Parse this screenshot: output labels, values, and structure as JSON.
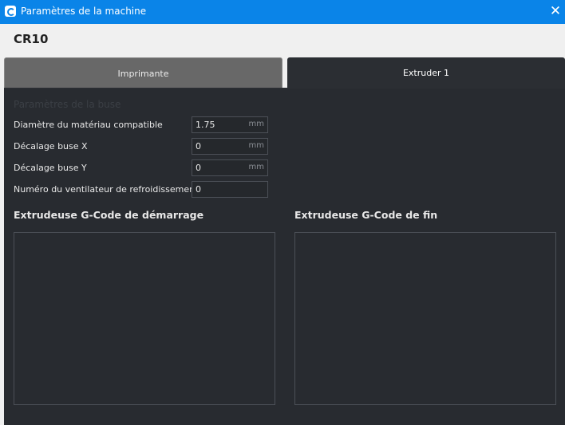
{
  "window": {
    "title": "Paramètres de la machine",
    "app_icon": "cura-logo-icon",
    "close_icon": "close-icon",
    "close_glyph": "✕"
  },
  "machine": {
    "name": "CR10"
  },
  "tabs": [
    {
      "label": "Imprimante",
      "active": false
    },
    {
      "label": "Extruder 1",
      "active": true
    }
  ],
  "nozzle_settings": {
    "heading": "Paramètres de la buse",
    "fields": [
      {
        "label": "Diamètre du matériau compatible",
        "value": "1.75",
        "unit": "mm"
      },
      {
        "label": "Décalage buse X",
        "value": "0",
        "unit": "mm"
      },
      {
        "label": "Décalage buse Y",
        "value": "0",
        "unit": "mm"
      },
      {
        "label": "Numéro du ventilateur de refroidissement",
        "value": "0",
        "unit": ""
      }
    ]
  },
  "gcode": {
    "start_heading": "Extrudeuse G-Code de démarrage",
    "start_value": "",
    "end_heading": "Extrudeuse G-Code de fin",
    "end_value": ""
  },
  "colors": {
    "titlebar": "#0a84e8",
    "panel": "#282b30",
    "tab_active": "#2b2e33",
    "tab_inactive": "#686868"
  }
}
